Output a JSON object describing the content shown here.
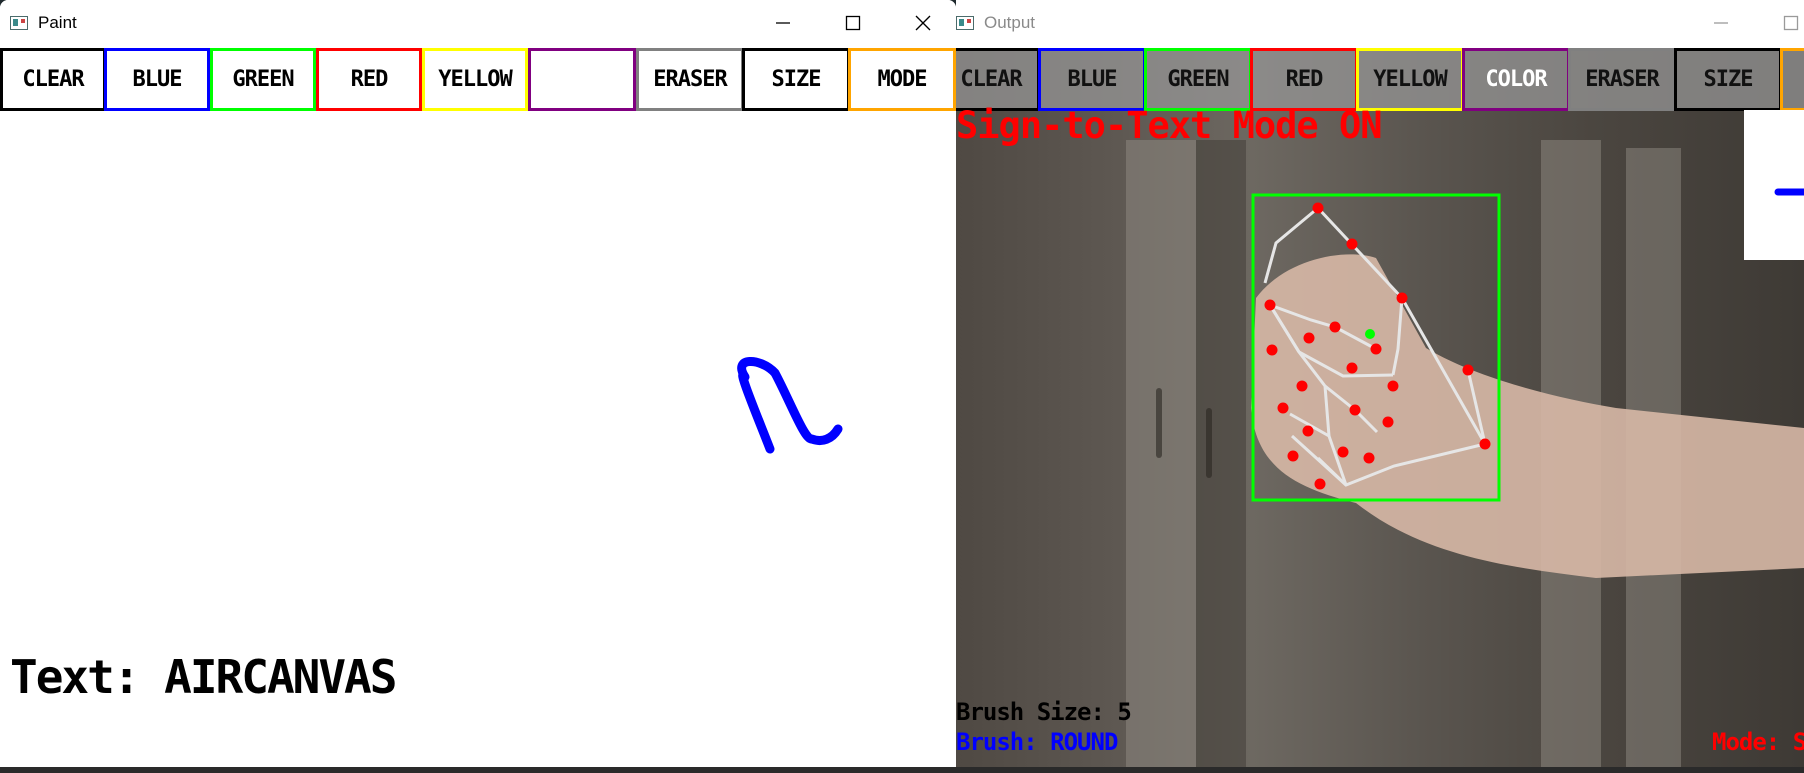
{
  "paint_window": {
    "title": "Paint",
    "toolbar": [
      {
        "label": "CLEAR",
        "color": "#000000"
      },
      {
        "label": "BLUE",
        "color": "#0000ff"
      },
      {
        "label": "GREEN",
        "color": "#00ff00"
      },
      {
        "label": "RED",
        "color": "#ff0000"
      },
      {
        "label": "YELLOW",
        "color": "#ffff00"
      },
      {
        "label": "",
        "color": "#800080"
      },
      {
        "label": "ERASER",
        "color": "#808080"
      },
      {
        "label": "SIZE",
        "color": "#000000"
      },
      {
        "label": "MODE",
        "color": "#ffa500"
      }
    ],
    "stroke_color": "#0000ff",
    "text_output": "Text: AIRCANVAS"
  },
  "output_window": {
    "title": "Output",
    "toolbar": [
      {
        "label": "CLEAR",
        "color": "#000000"
      },
      {
        "label": "BLUE",
        "color": "#0000ff"
      },
      {
        "label": "GREEN",
        "color": "#00ff00"
      },
      {
        "label": "RED",
        "color": "#ff0000"
      },
      {
        "label": "YELLOW",
        "color": "#ffff00"
      },
      {
        "label": "COLOR",
        "color": "#800080"
      },
      {
        "label": "ERASER",
        "color": "#808080"
      },
      {
        "label": "SIZE",
        "color": "#000000"
      },
      {
        "label": "",
        "color": "#ffa500"
      }
    ],
    "mode_status": "Sign-to-Text Mode ON",
    "brush_size": "Brush Size: 5",
    "brush_type": "Brush: ROUND",
    "mode_label": "Mode: S",
    "bounding_box_color": "#00ff00",
    "landmark_color": "#ff0000"
  },
  "icons": {
    "paint_app": "paint-app-icon",
    "minimize": "minimize-icon",
    "maximize": "maximize-icon",
    "close": "close-icon"
  }
}
